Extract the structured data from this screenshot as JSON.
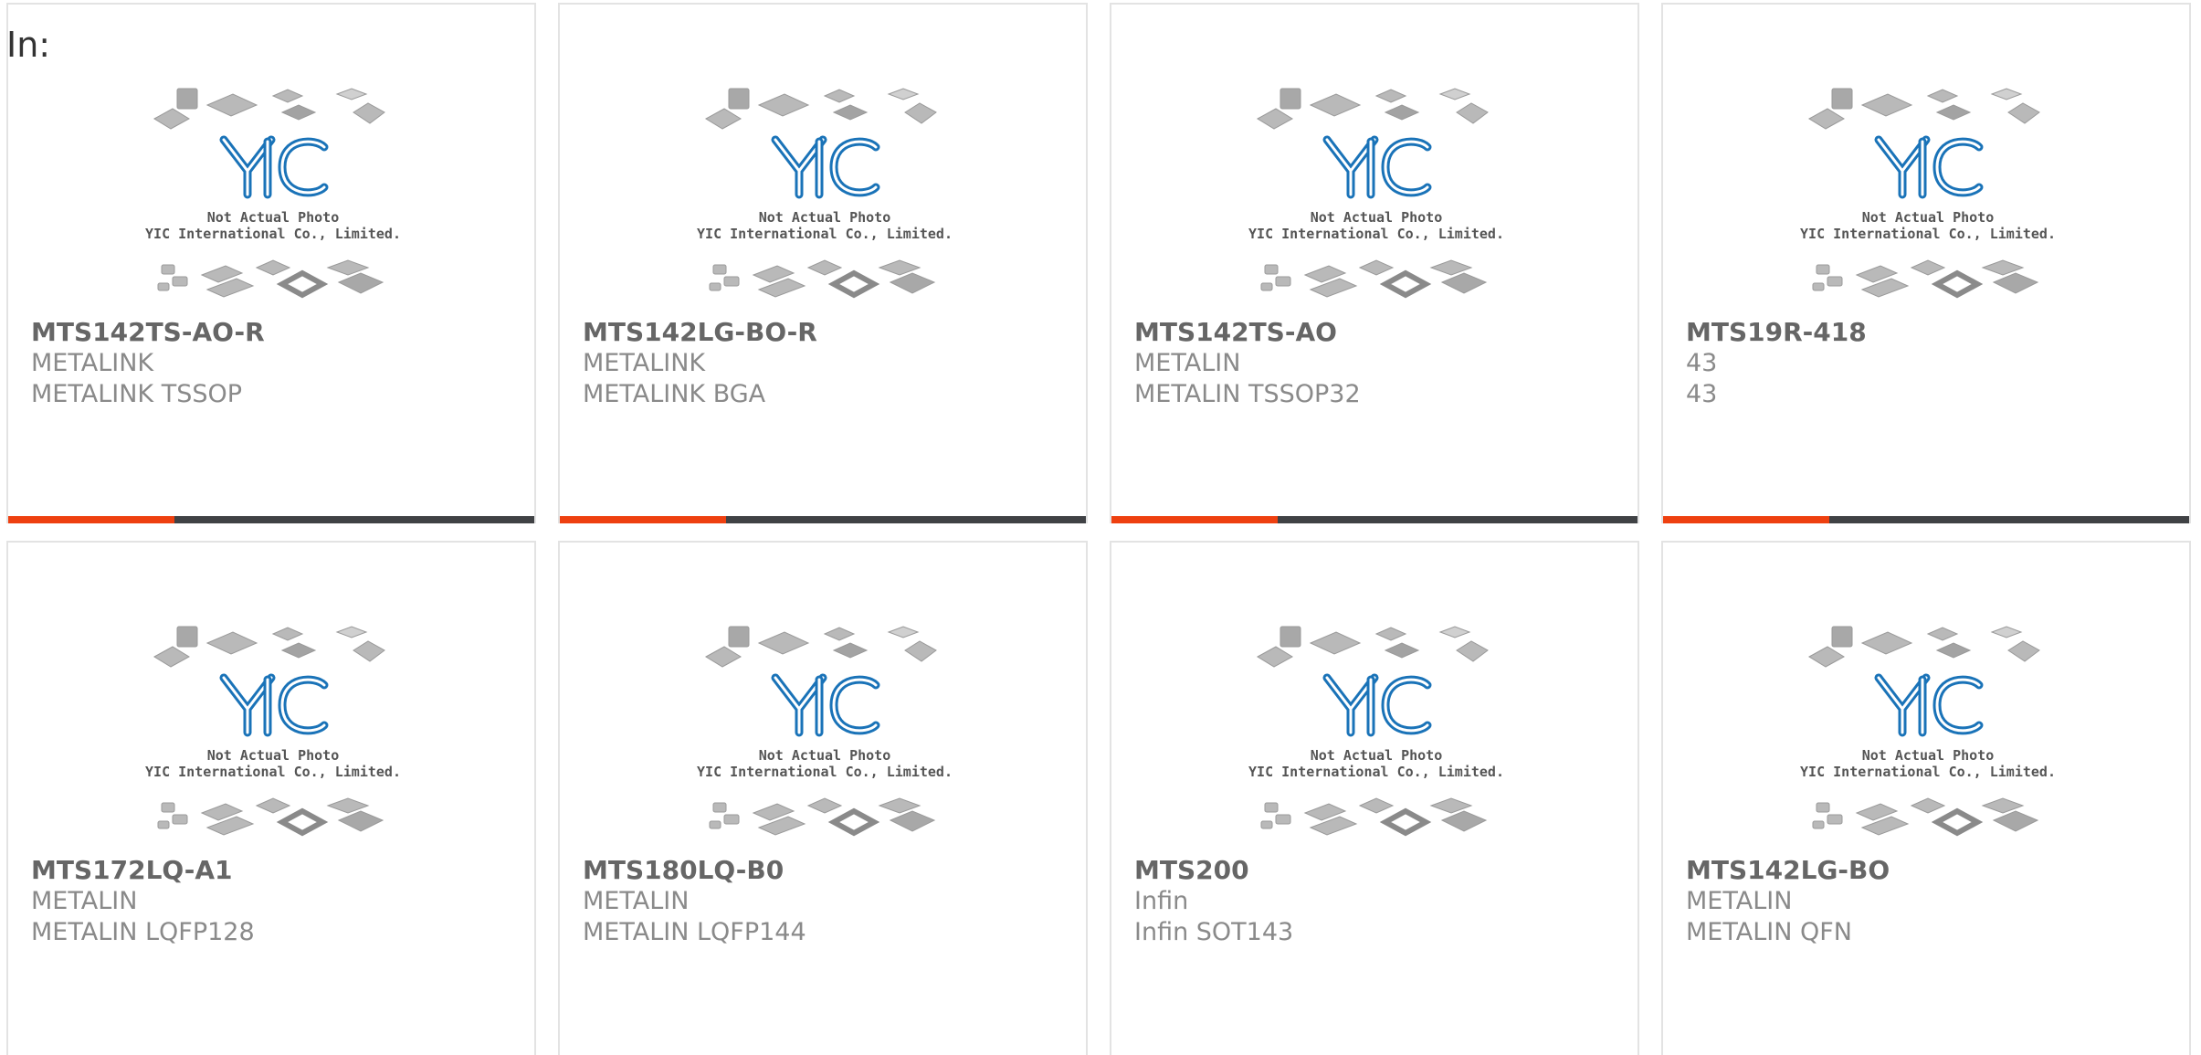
{
  "heading": "In:",
  "photo": {
    "caption_line1": "Not Actual Photo",
    "caption_line2": "YIC International Co., Limited.",
    "logo_text": "YIC",
    "logo_color": "#1a73b8"
  },
  "colors": {
    "accent": "#ee4010",
    "bar": "#404245",
    "border": "#e3e3e3"
  },
  "products": [
    {
      "part": "MTS142TS-AO-R",
      "manufacturer": "METALINK",
      "description": "METALINK TSSOP"
    },
    {
      "part": "MTS142LG-BO-R",
      "manufacturer": "METALINK",
      "description": "METALINK BGA"
    },
    {
      "part": "MTS142TS-AO",
      "manufacturer": "METALIN",
      "description": "METALIN TSSOP32"
    },
    {
      "part": "MTS19R-418",
      "manufacturer": "43",
      "description": "43"
    },
    {
      "part": "MTS172LQ-A1",
      "manufacturer": "METALIN",
      "description": "METALIN LQFP128"
    },
    {
      "part": "MTS180LQ-B0",
      "manufacturer": "METALIN",
      "description": "METALIN LQFP144"
    },
    {
      "part": "MTS200",
      "manufacturer": "Infin",
      "description": "Infin SOT143"
    },
    {
      "part": "MTS142LG-BO",
      "manufacturer": "METALIN",
      "description": "METALIN QFN"
    }
  ]
}
